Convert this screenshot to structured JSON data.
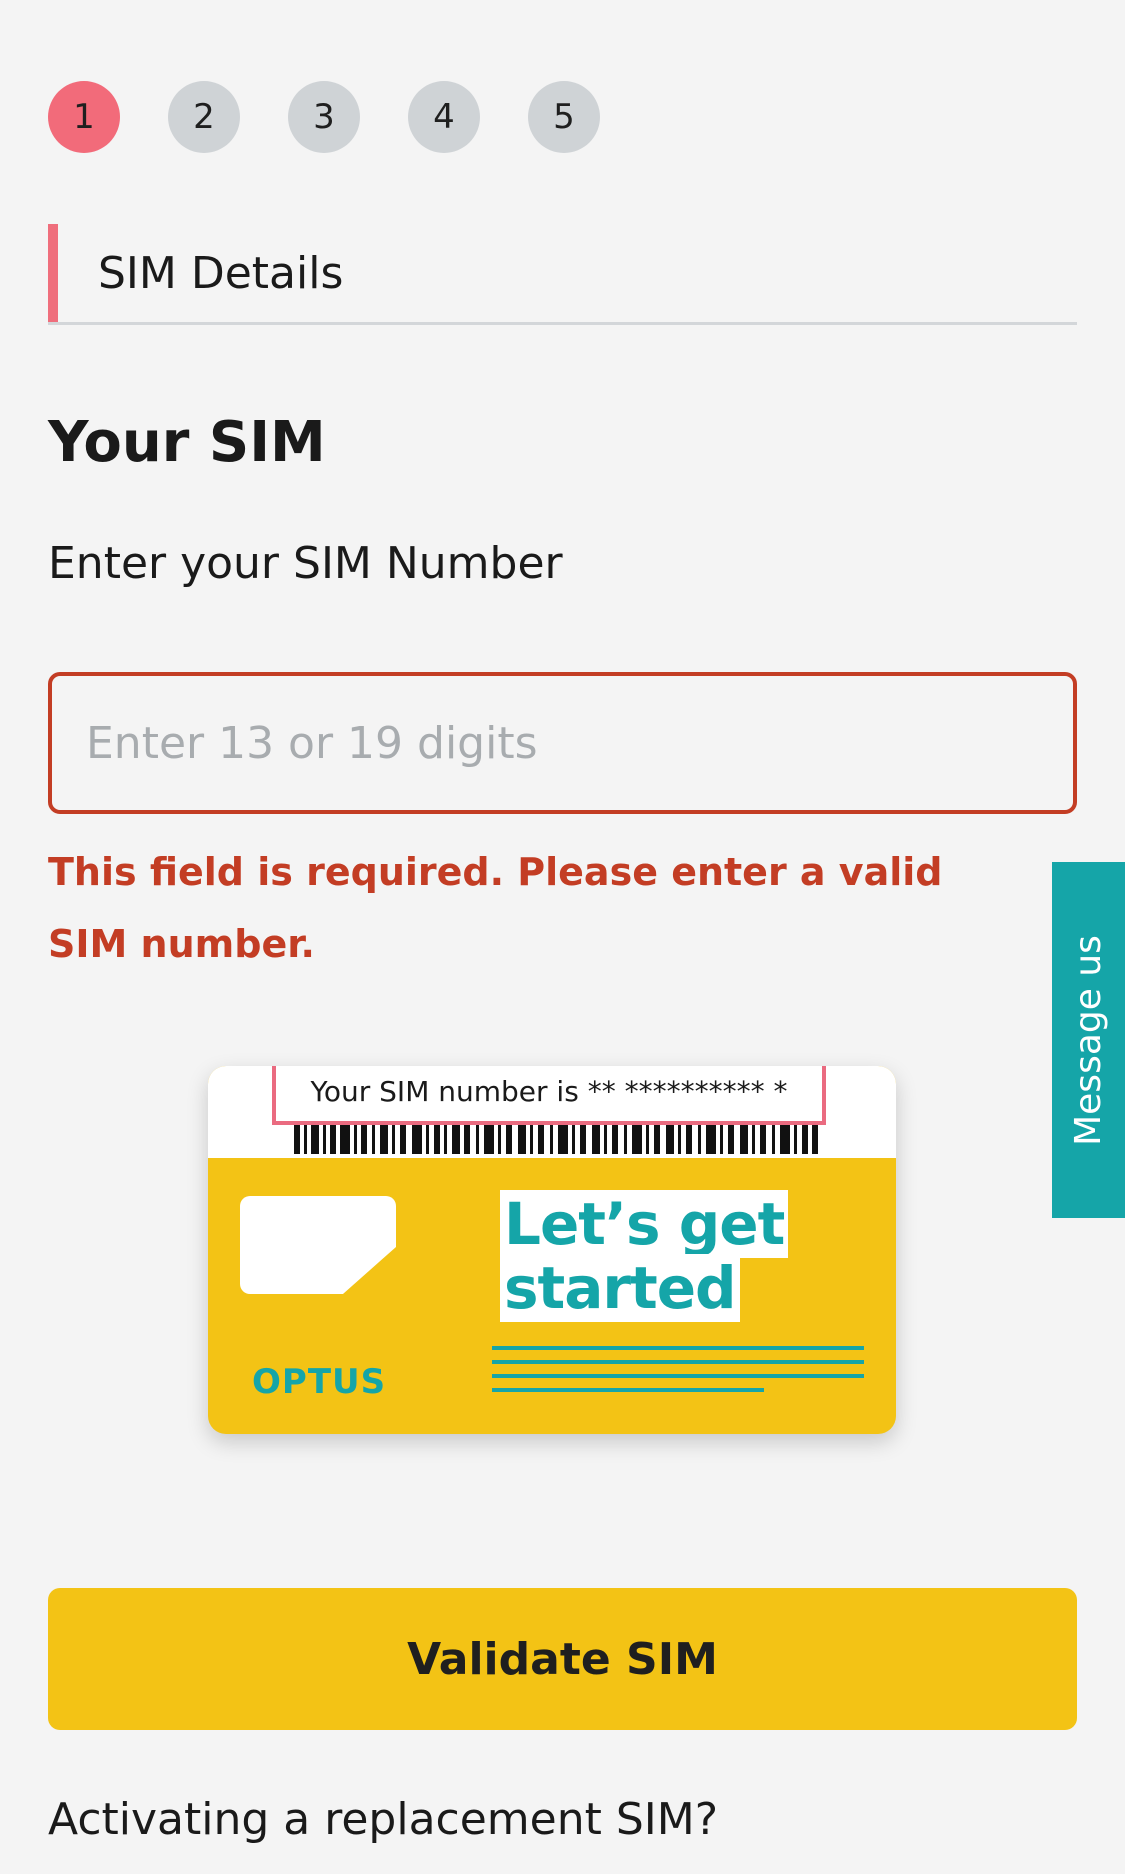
{
  "steps": [
    "1",
    "2",
    "3",
    "4",
    "5"
  ],
  "section_title": "SIM Details",
  "heading": "Your SIM",
  "field_label": "Enter your SIM Number",
  "input": {
    "value": "",
    "placeholder": "Enter 13 or 19 digits"
  },
  "error_message": "This field is required. Please enter a valid SIM number.",
  "sim_card": {
    "number_text": "Your SIM number is ** ********** *",
    "headline_line1": "Let’s get",
    "headline_line2": "started",
    "brand": "OPTUS"
  },
  "message_tab": "Message us",
  "validate_button": "Validate SIM",
  "replacement_link": "Activating a replacement SIM?",
  "colors": {
    "accent_red": "#c33d24",
    "step_active": "#f26b7a",
    "yellow": "#f3c315",
    "teal": "#15a5a8"
  }
}
